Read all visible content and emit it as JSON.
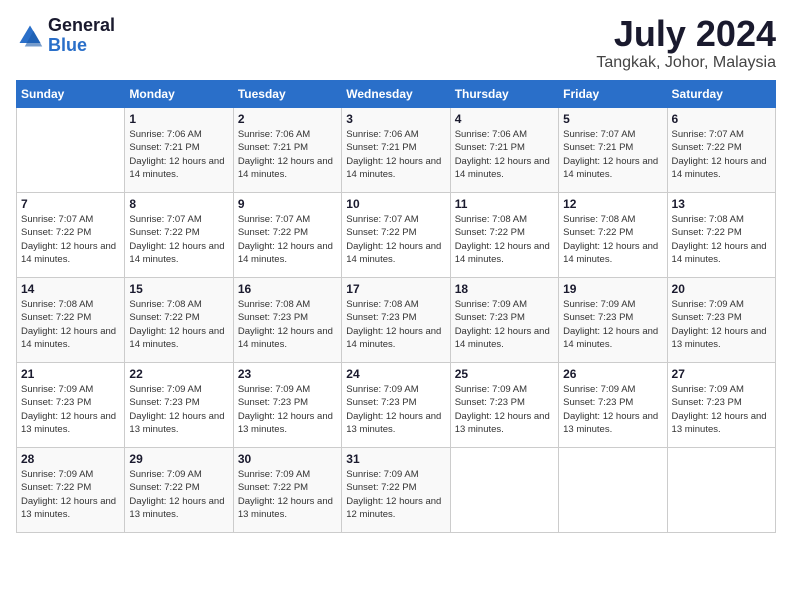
{
  "header": {
    "logo_general": "General",
    "logo_blue": "Blue",
    "month": "July 2024",
    "location": "Tangkak, Johor, Malaysia"
  },
  "days_of_week": [
    "Sunday",
    "Monday",
    "Tuesday",
    "Wednesday",
    "Thursday",
    "Friday",
    "Saturday"
  ],
  "weeks": [
    [
      {
        "day": "",
        "sunrise": "",
        "sunset": "",
        "daylight": ""
      },
      {
        "day": "1",
        "sunrise": "7:06 AM",
        "sunset": "7:21 PM",
        "daylight": "12 hours and 14 minutes."
      },
      {
        "day": "2",
        "sunrise": "7:06 AM",
        "sunset": "7:21 PM",
        "daylight": "12 hours and 14 minutes."
      },
      {
        "day": "3",
        "sunrise": "7:06 AM",
        "sunset": "7:21 PM",
        "daylight": "12 hours and 14 minutes."
      },
      {
        "day": "4",
        "sunrise": "7:06 AM",
        "sunset": "7:21 PM",
        "daylight": "12 hours and 14 minutes."
      },
      {
        "day": "5",
        "sunrise": "7:07 AM",
        "sunset": "7:21 PM",
        "daylight": "12 hours and 14 minutes."
      },
      {
        "day": "6",
        "sunrise": "7:07 AM",
        "sunset": "7:22 PM",
        "daylight": "12 hours and 14 minutes."
      }
    ],
    [
      {
        "day": "7",
        "sunrise": "7:07 AM",
        "sunset": "7:22 PM",
        "daylight": "12 hours and 14 minutes."
      },
      {
        "day": "8",
        "sunrise": "7:07 AM",
        "sunset": "7:22 PM",
        "daylight": "12 hours and 14 minutes."
      },
      {
        "day": "9",
        "sunrise": "7:07 AM",
        "sunset": "7:22 PM",
        "daylight": "12 hours and 14 minutes."
      },
      {
        "day": "10",
        "sunrise": "7:07 AM",
        "sunset": "7:22 PM",
        "daylight": "12 hours and 14 minutes."
      },
      {
        "day": "11",
        "sunrise": "7:08 AM",
        "sunset": "7:22 PM",
        "daylight": "12 hours and 14 minutes."
      },
      {
        "day": "12",
        "sunrise": "7:08 AM",
        "sunset": "7:22 PM",
        "daylight": "12 hours and 14 minutes."
      },
      {
        "day": "13",
        "sunrise": "7:08 AM",
        "sunset": "7:22 PM",
        "daylight": "12 hours and 14 minutes."
      }
    ],
    [
      {
        "day": "14",
        "sunrise": "7:08 AM",
        "sunset": "7:22 PM",
        "daylight": "12 hours and 14 minutes."
      },
      {
        "day": "15",
        "sunrise": "7:08 AM",
        "sunset": "7:22 PM",
        "daylight": "12 hours and 14 minutes."
      },
      {
        "day": "16",
        "sunrise": "7:08 AM",
        "sunset": "7:23 PM",
        "daylight": "12 hours and 14 minutes."
      },
      {
        "day": "17",
        "sunrise": "7:08 AM",
        "sunset": "7:23 PM",
        "daylight": "12 hours and 14 minutes."
      },
      {
        "day": "18",
        "sunrise": "7:09 AM",
        "sunset": "7:23 PM",
        "daylight": "12 hours and 14 minutes."
      },
      {
        "day": "19",
        "sunrise": "7:09 AM",
        "sunset": "7:23 PM",
        "daylight": "12 hours and 14 minutes."
      },
      {
        "day": "20",
        "sunrise": "7:09 AM",
        "sunset": "7:23 PM",
        "daylight": "12 hours and 13 minutes."
      }
    ],
    [
      {
        "day": "21",
        "sunrise": "7:09 AM",
        "sunset": "7:23 PM",
        "daylight": "12 hours and 13 minutes."
      },
      {
        "day": "22",
        "sunrise": "7:09 AM",
        "sunset": "7:23 PM",
        "daylight": "12 hours and 13 minutes."
      },
      {
        "day": "23",
        "sunrise": "7:09 AM",
        "sunset": "7:23 PM",
        "daylight": "12 hours and 13 minutes."
      },
      {
        "day": "24",
        "sunrise": "7:09 AM",
        "sunset": "7:23 PM",
        "daylight": "12 hours and 13 minutes."
      },
      {
        "day": "25",
        "sunrise": "7:09 AM",
        "sunset": "7:23 PM",
        "daylight": "12 hours and 13 minutes."
      },
      {
        "day": "26",
        "sunrise": "7:09 AM",
        "sunset": "7:23 PM",
        "daylight": "12 hours and 13 minutes."
      },
      {
        "day": "27",
        "sunrise": "7:09 AM",
        "sunset": "7:23 PM",
        "daylight": "12 hours and 13 minutes."
      }
    ],
    [
      {
        "day": "28",
        "sunrise": "7:09 AM",
        "sunset": "7:22 PM",
        "daylight": "12 hours and 13 minutes."
      },
      {
        "day": "29",
        "sunrise": "7:09 AM",
        "sunset": "7:22 PM",
        "daylight": "12 hours and 13 minutes."
      },
      {
        "day": "30",
        "sunrise": "7:09 AM",
        "sunset": "7:22 PM",
        "daylight": "12 hours and 13 minutes."
      },
      {
        "day": "31",
        "sunrise": "7:09 AM",
        "sunset": "7:22 PM",
        "daylight": "12 hours and 12 minutes."
      },
      {
        "day": "",
        "sunrise": "",
        "sunset": "",
        "daylight": ""
      },
      {
        "day": "",
        "sunrise": "",
        "sunset": "",
        "daylight": ""
      },
      {
        "day": "",
        "sunrise": "",
        "sunset": "",
        "daylight": ""
      }
    ]
  ],
  "labels": {
    "sunrise_prefix": "Sunrise: ",
    "sunset_prefix": "Sunset: ",
    "daylight_prefix": "Daylight: "
  }
}
